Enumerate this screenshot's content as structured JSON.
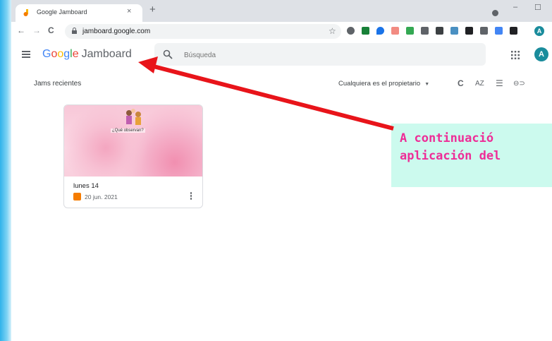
{
  "browser": {
    "tab_title": "Google Jamboard",
    "tab_close": "×",
    "new_tab": "+",
    "minimize": "–",
    "maximize": "☐",
    "back": "←",
    "forward": "→",
    "reload": "C",
    "url": "jamboard.google.com",
    "bookmark_star": "☆",
    "profile_initial": "A"
  },
  "app": {
    "logo_google": [
      "G",
      "o",
      "o",
      "g",
      "l",
      "e"
    ],
    "product_name": "Jamboard",
    "search_placeholder": "Búsqueda",
    "avatar_initial": "A"
  },
  "list": {
    "section_title": "Jams recientes",
    "owner_filter": "Cualquiera es el propietario",
    "reload_icon": "C",
    "sort_icon": "AZ",
    "list_view_icon": "☰",
    "link_icon": "⊖⊃"
  },
  "jams": [
    {
      "name": "lunes 14",
      "date": "20 jun. 2021",
      "thumbnail_caption": "¿Qué observan?"
    }
  ],
  "annotation": {
    "text": "A continuació\naplicación del",
    "text_color": "#ee2d97",
    "background": "#ccfaee",
    "arrow_color": "#e8141a"
  },
  "colors": {
    "accent": "#1a8c9c",
    "tabstrip": "#dee1e6"
  }
}
